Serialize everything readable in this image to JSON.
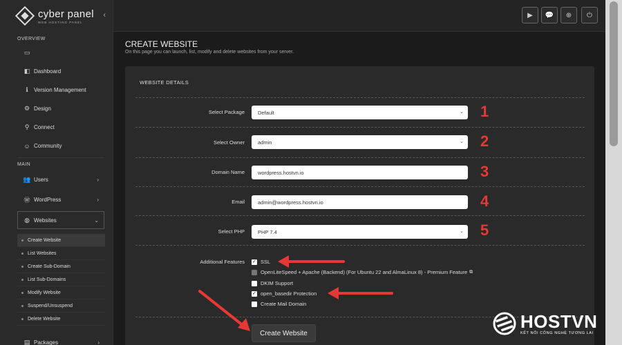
{
  "sidebar": {
    "logo_title": "cyber panel",
    "logo_subtitle": "WEB HOSTING PANEL",
    "collapse_glyph": "‹",
    "overview_label": "OVERVIEW",
    "main_label": "MAIN",
    "overview_items": [
      {
        "icon": "monitor-icon",
        "label": ""
      },
      {
        "icon": "dashboard-icon",
        "label": "Dashboard"
      },
      {
        "icon": "info-icon",
        "label": "Version Management"
      },
      {
        "icon": "gear-icon",
        "label": "Design"
      },
      {
        "icon": "connect-icon",
        "label": "Connect"
      },
      {
        "icon": "community-icon",
        "label": "Community"
      }
    ],
    "main_items": [
      {
        "icon": "users-icon",
        "label": "Users"
      },
      {
        "icon": "wordpress-icon",
        "label": "WordPress"
      },
      {
        "icon": "globe-icon",
        "label": "Websites"
      },
      {
        "icon": "packages-icon",
        "label": "Packages"
      }
    ],
    "website_subitems": [
      "Create Website",
      "List Websites",
      "Create Sub-Domain",
      "List Sub-Domains",
      "Modify Website",
      "Suspend/Unsuspend",
      "Delete Website"
    ]
  },
  "topbar": {
    "buttons": [
      "youtube-icon",
      "chat-icon",
      "support-icon",
      "power-icon"
    ]
  },
  "page": {
    "title": "CREATE WEBSITE",
    "subtitle": "On this page you can launch, list, modify and delete websites from your server."
  },
  "form": {
    "section_title": "WEBSITE DETAILS",
    "fields": [
      {
        "label": "Select Package",
        "value": "Default",
        "type": "select",
        "marker": "1"
      },
      {
        "label": "Select Owner",
        "value": "admin",
        "type": "select",
        "marker": "2"
      },
      {
        "label": "Domain Name",
        "value": "wordpress.hostvn.io",
        "type": "text",
        "marker": "3"
      },
      {
        "label": "Email",
        "value": "admin@wordpress.hostvn.io",
        "type": "text",
        "marker": "4"
      },
      {
        "label": "Select PHP",
        "value": "PHP 7.4",
        "type": "select",
        "marker": "5"
      }
    ],
    "features_label": "Additional Features",
    "features": [
      {
        "label": "SSL",
        "checked": true
      },
      {
        "label": "OpenLiteSpeed + Apache (Backend) (For Ubuntu 22 and AlmaLinux 8) - Premium Feature",
        "checked": false,
        "disabled": true
      },
      {
        "label": "DKIM Support",
        "checked": false
      },
      {
        "label": "open_basedir Protection",
        "checked": true
      },
      {
        "label": "Create Mail Domain",
        "checked": false
      }
    ],
    "submit_label": "Create Website"
  },
  "brand": {
    "name": "HOSTVN",
    "tagline": "KẾT NỐI CÔNG NGHỆ TƯƠNG LAI"
  },
  "colors": {
    "annotation_red": "#e53935",
    "panel_bg": "#2a2a2a",
    "page_bg": "#1b1b1b"
  }
}
